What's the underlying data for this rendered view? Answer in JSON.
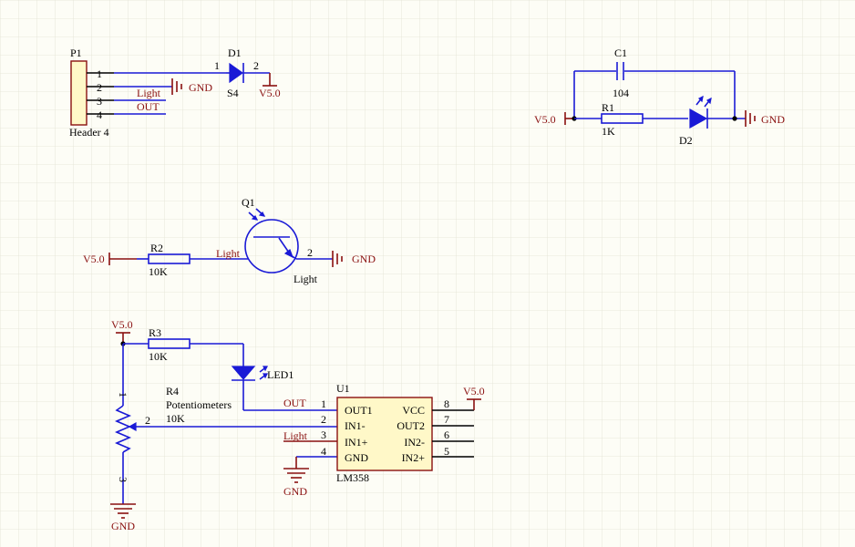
{
  "header": {
    "ref": "P1",
    "name": "Header 4",
    "pins": [
      "1",
      "2",
      "3",
      "4"
    ],
    "net_light": "Light",
    "net_out": "OUT"
  },
  "d1": {
    "ref": "D1",
    "value": "S4",
    "pin1": "1",
    "pin2": "2"
  },
  "c1": {
    "ref": "C1",
    "value": "104"
  },
  "r1": {
    "ref": "R1",
    "value": "1K"
  },
  "d2": {
    "ref": "D2"
  },
  "q1": {
    "ref": "Q1",
    "pin2": "2",
    "net_in": "Light",
    "net_out": "Light"
  },
  "r2": {
    "ref": "R2",
    "value": "10K"
  },
  "r3": {
    "ref": "R3",
    "value": "10K"
  },
  "led1": {
    "ref": "LED1"
  },
  "r4": {
    "ref": "R4",
    "name": "Potentiometers",
    "value": "10K",
    "pin1": "1",
    "pin2": "2",
    "pin3": "3"
  },
  "u1": {
    "ref": "U1",
    "part": "LM358",
    "left_pins": [
      {
        "num": "1",
        "name": "OUT1"
      },
      {
        "num": "2",
        "name": "IN1-"
      },
      {
        "num": "3",
        "name": "IN1+"
      },
      {
        "num": "4",
        "name": "GND"
      }
    ],
    "right_pins": [
      {
        "num": "8",
        "name": "VCC"
      },
      {
        "num": "7",
        "name": "OUT2"
      },
      {
        "num": "6",
        "name": "IN2-"
      },
      {
        "num": "5",
        "name": "IN2+"
      }
    ],
    "net_out": "OUT",
    "net_light": "Light"
  },
  "power": {
    "v5": "V5.0",
    "gnd": "GND"
  },
  "colors": {
    "wire": "#1a1ad6",
    "net": "#8a1010",
    "grid": "#e2e2d4",
    "background": "#fdfdf6"
  }
}
